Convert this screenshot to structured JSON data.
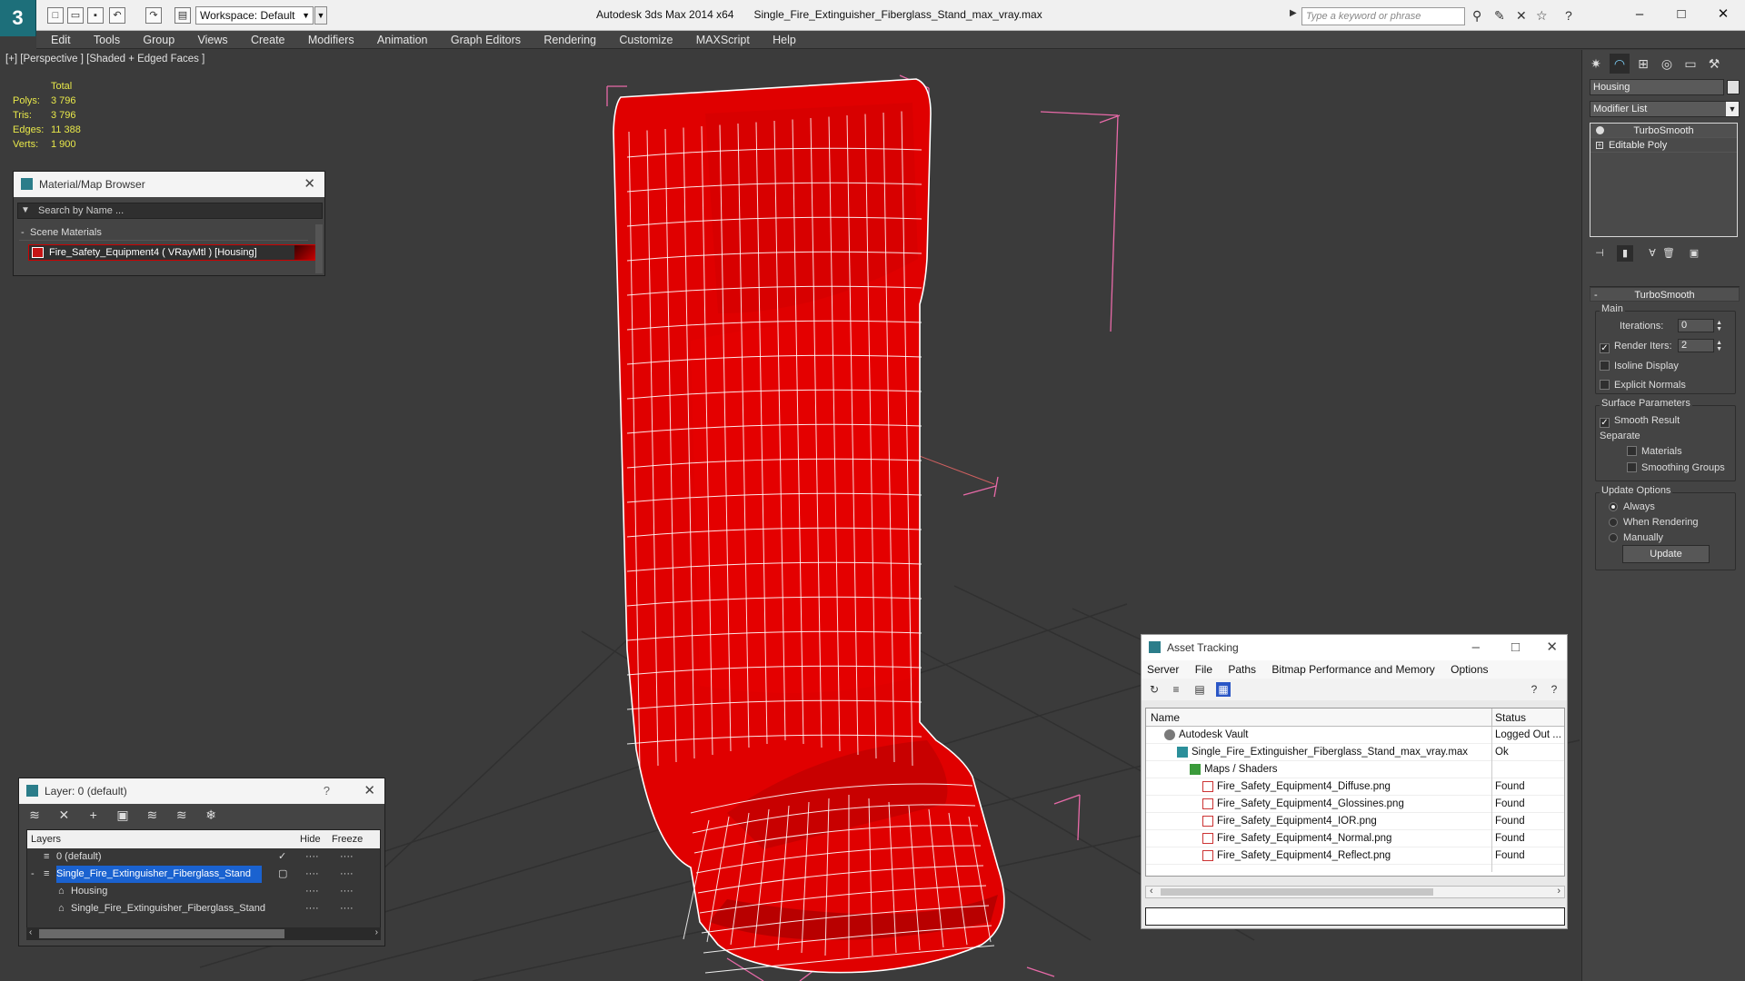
{
  "app": {
    "name": "Autodesk 3ds Max  2014 x64",
    "file": "Single_Fire_Extinguisher_Fiberglass_Stand_max_vray.max",
    "logo": "3"
  },
  "toolbar": {
    "workspace": "Workspace: Default",
    "search_placeholder": "Type a keyword or phrase"
  },
  "menu": [
    "Edit",
    "Tools",
    "Group",
    "Views",
    "Create",
    "Modifiers",
    "Animation",
    "Graph Editors",
    "Rendering",
    "Customize",
    "MAXScript",
    "Help"
  ],
  "viewport": {
    "label": "[+] [Perspective ] [Shaded + Edged Faces ]",
    "stats": {
      "header": "Total",
      "rows": [
        {
          "k": "Polys:",
          "v": "3 796"
        },
        {
          "k": "Tris:",
          "v": "3 796"
        },
        {
          "k": "Edges:",
          "v": "11 388"
        },
        {
          "k": "Verts:",
          "v": "1 900"
        }
      ]
    },
    "colors": {
      "mesh": "#e00000",
      "wire": "#ffffff",
      "bbox": "#e86aa8",
      "bg": "#3b3b3b"
    }
  },
  "material_browser": {
    "title": "Material/Map Browser",
    "search_placeholder": "Search by Name ...",
    "section": "Scene Materials",
    "item": "Fire_Safety_Equipment4  ( VRayMtl )  [Housing]"
  },
  "layer_dialog": {
    "title": "Layer: 0 (default)",
    "columns": {
      "layers": "Layers",
      "hide": "Hide",
      "freeze": "Freeze"
    },
    "rows": [
      {
        "name": "0 (default)"
      },
      {
        "name": "Single_Fire_Extinguisher_Fiberglass_Stand"
      },
      {
        "name": "Housing"
      },
      {
        "name": "Single_Fire_Extinguisher_Fiberglass_Stand"
      }
    ]
  },
  "asset_tracking": {
    "title": "Asset Tracking",
    "menu": [
      "Server",
      "File",
      "Paths",
      "Bitmap Performance and Memory",
      "Options"
    ],
    "columns": {
      "name": "Name",
      "status": "Status"
    },
    "rows": [
      {
        "name": "Autodesk Vault",
        "status": "Logged Out ...",
        "indent": 0,
        "icon": "vault"
      },
      {
        "name": "Single_Fire_Extinguisher_Fiberglass_Stand_max_vray.max",
        "status": "Ok",
        "indent": 1,
        "icon": "max"
      },
      {
        "name": "Maps / Shaders",
        "status": "",
        "indent": 2,
        "icon": "maps"
      },
      {
        "name": "Fire_Safety_Equipment4_Diffuse.png",
        "status": "Found",
        "indent": 3,
        "icon": "png"
      },
      {
        "name": "Fire_Safety_Equipment4_Glossines.png",
        "status": "Found",
        "indent": 3,
        "icon": "png"
      },
      {
        "name": "Fire_Safety_Equipment4_IOR.png",
        "status": "Found",
        "indent": 3,
        "icon": "png"
      },
      {
        "name": "Fire_Safety_Equipment4_Normal.png",
        "status": "Found",
        "indent": 3,
        "icon": "png"
      },
      {
        "name": "Fire_Safety_Equipment4_Reflect.png",
        "status": "Found",
        "indent": 3,
        "icon": "png"
      }
    ]
  },
  "command_panel": {
    "object_name": "Housing",
    "modifier_list": "Modifier List",
    "stack": [
      "TurboSmooth",
      "Editable Poly"
    ],
    "rollout": {
      "title": "TurboSmooth",
      "main": "Main",
      "iterations_label": "Iterations:",
      "iterations": "0",
      "render_iters_label": "Render Iters:",
      "render_iters": "2",
      "render_iters_checked": true,
      "isoline": "Isoline Display",
      "explicit": "Explicit Normals",
      "surface": "Surface Parameters",
      "smooth_result": "Smooth Result",
      "separate": "Separate",
      "materials": "Materials",
      "smoothing_groups": "Smoothing Groups",
      "update_options": "Update Options",
      "always": "Always",
      "when_rendering": "When Rendering",
      "manually": "Manually",
      "update_button": "Update"
    }
  }
}
